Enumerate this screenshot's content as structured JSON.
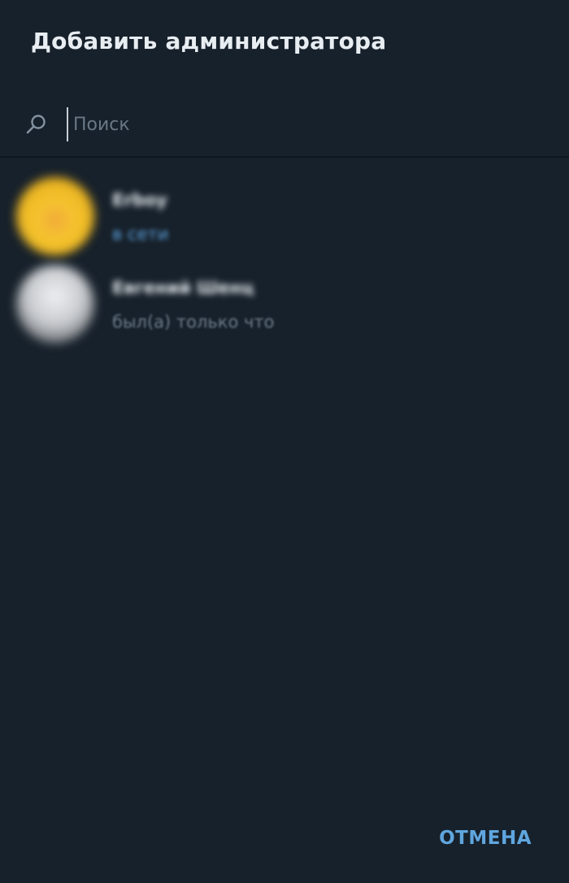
{
  "dialog": {
    "title": "Добавить администратора"
  },
  "search": {
    "placeholder": "Поиск",
    "icon": "search-icon"
  },
  "contacts": [
    {
      "name": "Erboy",
      "status": "в сети",
      "status_type": "online"
    },
    {
      "name": "Евгений Шенц",
      "status": "был(а) только что",
      "status_type": "offline"
    }
  ],
  "footer": {
    "cancel_label": "ОТМЕНА"
  },
  "colors": {
    "background": "#17212b",
    "accent": "#5fa6df",
    "online": "#5ea4e0",
    "muted": "#6e7c89"
  }
}
